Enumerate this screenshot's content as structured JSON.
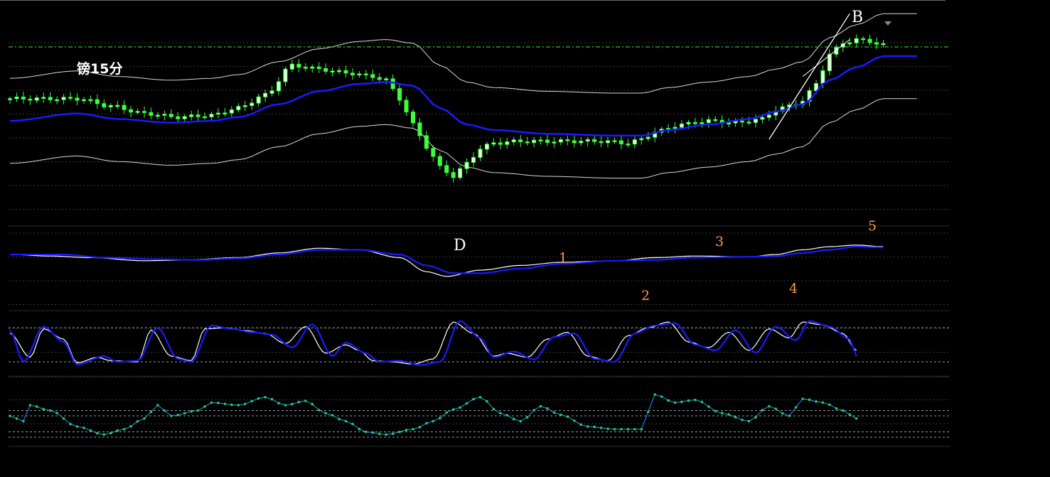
{
  "title": "镑15分",
  "colors": {
    "background": "#000000",
    "candle": "#3cff3c",
    "candle_up_body": "#e8ffe8",
    "ma_blue": "#1a1aff",
    "band_white": "#ffffff",
    "grid": "#3a3a3a",
    "guide_green": "#2fbf2f",
    "orange": "#ff9a4a",
    "osc_dots": "#22d050",
    "osc_line": "#2a78e0"
  },
  "annotations": [
    {
      "id": "label-b",
      "text": "B",
      "color": "#ffffff"
    },
    {
      "id": "label-d",
      "text": "D",
      "color": "#ffffff"
    },
    {
      "id": "label-1",
      "text": "1",
      "color": "#ff9a4a"
    },
    {
      "id": "label-2",
      "text": "2",
      "color": "#ff9a4a"
    },
    {
      "id": "label-3",
      "text": "3",
      "color": "#ff9a4a"
    },
    {
      "id": "label-4",
      "text": "4",
      "color": "#ff9a4a"
    },
    {
      "id": "label-5",
      "text": "5",
      "color": "#ff9a4a"
    }
  ],
  "chart_data": {
    "type": "candlestick",
    "title": "镑15分",
    "grid": true,
    "panels": [
      {
        "name": "price",
        "type": "candlestick",
        "bars": 136,
        "ylim": [
          0,
          100
        ],
        "close_keypoints": [
          [
            0,
            62
          ],
          [
            10,
            62
          ],
          [
            15,
            58
          ],
          [
            20,
            54
          ],
          [
            25,
            52
          ],
          [
            30,
            53
          ],
          [
            34,
            57
          ],
          [
            38,
            64
          ],
          [
            42,
            80
          ],
          [
            46,
            78
          ],
          [
            50,
            76
          ],
          [
            54,
            74
          ],
          [
            56,
            72
          ],
          [
            58,
            62
          ],
          [
            60,
            48
          ],
          [
            62,
            36
          ],
          [
            64,
            25
          ],
          [
            66,
            20
          ],
          [
            68,
            27
          ],
          [
            70,
            35
          ],
          [
            72,
            38
          ],
          [
            76,
            39
          ],
          [
            80,
            39
          ],
          [
            84,
            39
          ],
          [
            88,
            39
          ],
          [
            92,
            38
          ],
          [
            94,
            40
          ],
          [
            96,
            44
          ],
          [
            100,
            48
          ],
          [
            104,
            50
          ],
          [
            108,
            49
          ],
          [
            112,
            51
          ],
          [
            114,
            56
          ],
          [
            116,
            58
          ],
          [
            118,
            61
          ],
          [
            120,
            70
          ],
          [
            122,
            86
          ],
          [
            124,
            92
          ],
          [
            126,
            94
          ],
          [
            128,
            93
          ],
          [
            130,
            91
          ]
        ],
        "ma_keypoints": [
          [
            0,
            50
          ],
          [
            10,
            54
          ],
          [
            16,
            51
          ],
          [
            24,
            49
          ],
          [
            30,
            50
          ],
          [
            34,
            52
          ],
          [
            40,
            59
          ],
          [
            46,
            66
          ],
          [
            52,
            70
          ],
          [
            56,
            71
          ],
          [
            60,
            69
          ],
          [
            64,
            57
          ],
          [
            68,
            48
          ],
          [
            72,
            45
          ],
          [
            80,
            43
          ],
          [
            90,
            42
          ],
          [
            94,
            42
          ],
          [
            98,
            45
          ],
          [
            104,
            48
          ],
          [
            110,
            51
          ],
          [
            114,
            55
          ],
          [
            118,
            59
          ],
          [
            122,
            72
          ],
          [
            126,
            79
          ],
          [
            130,
            85
          ]
        ],
        "band_width": 23,
        "hlines": [
          {
            "y": 90,
            "style": "dash-dot",
            "color": "#2fbf2f"
          }
        ],
        "trendline": {
          "from": [
            113,
            40
          ],
          "to": [
            125,
            108
          ],
          "color": "#ffffff"
        }
      },
      {
        "name": "moving-average-oscillator",
        "type": "line",
        "ylim": [
          0,
          100
        ],
        "series": [
          {
            "color": "#ffffff",
            "keypoints": [
              [
                0,
                70
              ],
              [
                6,
                68
              ],
              [
                12,
                66
              ],
              [
                20,
                62
              ],
              [
                26,
                63
              ],
              [
                34,
                66
              ],
              [
                40,
                72
              ],
              [
                46,
                78
              ],
              [
                52,
                76
              ],
              [
                58,
                66
              ],
              [
                62,
                48
              ],
              [
                65,
                42
              ],
              [
                70,
                50
              ],
              [
                76,
                56
              ],
              [
                82,
                60
              ],
              [
                90,
                62
              ],
              [
                96,
                66
              ],
              [
                102,
                68
              ],
              [
                110,
                67
              ],
              [
                114,
                70
              ],
              [
                118,
                76
              ],
              [
                122,
                80
              ],
              [
                126,
                82
              ],
              [
                130,
                80
              ]
            ]
          },
          {
            "color": "#1a1aff",
            "keypoints": [
              [
                0,
                70
              ],
              [
                8,
                70
              ],
              [
                14,
                66
              ],
              [
                22,
                64
              ],
              [
                28,
                63
              ],
              [
                34,
                65
              ],
              [
                40,
                70
              ],
              [
                46,
                76
              ],
              [
                52,
                76
              ],
              [
                58,
                70
              ],
              [
                62,
                56
              ],
              [
                66,
                46
              ],
              [
                70,
                46
              ],
              [
                76,
                52
              ],
              [
                82,
                58
              ],
              [
                90,
                62
              ],
              [
                96,
                63
              ],
              [
                102,
                66
              ],
              [
                110,
                67
              ],
              [
                114,
                68
              ],
              [
                118,
                72
              ],
              [
                122,
                76
              ],
              [
                126,
                80
              ],
              [
                130,
                79
              ]
            ]
          }
        ]
      },
      {
        "name": "stochastic",
        "type": "line",
        "ylim": [
          0,
          100
        ],
        "hlines": [
          80,
          20
        ],
        "series": [
          {
            "color": "#ffffff",
            "keypoints": [
              [
                0,
                70
              ],
              [
                3,
                28
              ],
              [
                5,
                78
              ],
              [
                8,
                60
              ],
              [
                10,
                18
              ],
              [
                13,
                28
              ],
              [
                15,
                22
              ],
              [
                19,
                20
              ],
              [
                21,
                76
              ],
              [
                24,
                30
              ],
              [
                27,
                22
              ],
              [
                29,
                78
              ],
              [
                32,
                80
              ],
              [
                35,
                75
              ],
              [
                38,
                70
              ],
              [
                41,
                52
              ],
              [
                44,
                82
              ],
              [
                47,
                35
              ],
              [
                50,
                50
              ],
              [
                52,
                40
              ],
              [
                54,
                22
              ],
              [
                57,
                20
              ],
              [
                60,
                16
              ],
              [
                63,
                25
              ],
              [
                66,
                90
              ],
              [
                69,
                70
              ],
              [
                72,
                30
              ],
              [
                74,
                35
              ],
              [
                77,
                28
              ],
              [
                80,
                60
              ],
              [
                83,
                72
              ],
              [
                86,
                30
              ],
              [
                89,
                22
              ],
              [
                92,
                66
              ],
              [
                95,
                80
              ],
              [
                98,
                90
              ],
              [
                101,
                55
              ],
              [
                104,
                45
              ],
              [
                107,
                72
              ],
              [
                110,
                40
              ],
              [
                113,
                78
              ],
              [
                116,
                62
              ],
              [
                118,
                90
              ],
              [
                121,
                85
              ],
              [
                124,
                70
              ],
              [
                126,
                40
              ]
            ]
          },
          {
            "color": "#1a1aff",
            "keypoints": [
              [
                0,
                75
              ],
              [
                2,
                20
              ],
              [
                5,
                82
              ],
              [
                8,
                55
              ],
              [
                10,
                15
              ],
              [
                14,
                30
              ],
              [
                16,
                20
              ],
              [
                19,
                22
              ],
              [
                22,
                80
              ],
              [
                25,
                25
              ],
              [
                27,
                20
              ],
              [
                30,
                84
              ],
              [
                33,
                78
              ],
              [
                36,
                72
              ],
              [
                39,
                68
              ],
              [
                42,
                45
              ],
              [
                45,
                86
              ],
              [
                48,
                30
              ],
              [
                50,
                54
              ],
              [
                53,
                35
              ],
              [
                55,
                20
              ],
              [
                58,
                22
              ],
              [
                61,
                14
              ],
              [
                64,
                20
              ],
              [
                67,
                92
              ],
              [
                70,
                62
              ],
              [
                72,
                28
              ],
              [
                75,
                38
              ],
              [
                78,
                24
              ],
              [
                81,
                64
              ],
              [
                84,
                70
              ],
              [
                87,
                25
              ],
              [
                90,
                20
              ],
              [
                93,
                70
              ],
              [
                96,
                84
              ],
              [
                99,
                88
              ],
              [
                102,
                50
              ],
              [
                105,
                40
              ],
              [
                108,
                76
              ],
              [
                111,
                36
              ],
              [
                114,
                82
              ],
              [
                117,
                58
              ],
              [
                119,
                92
              ],
              [
                122,
                82
              ],
              [
                125,
                60
              ],
              [
                126,
                30
              ]
            ]
          }
        ]
      },
      {
        "name": "momentum",
        "type": "line",
        "ylim": [
          0,
          100
        ],
        "hlines": [
          50,
          40,
          10,
          0
        ],
        "series": [
          {
            "color": "#2a78e0",
            "marker": "dot",
            "keypoints": [
              [
                0,
                40
              ],
              [
                2,
                30
              ],
              [
                3,
                60
              ],
              [
                6,
                50
              ],
              [
                10,
                20
              ],
              [
                14,
                5
              ],
              [
                17,
                15
              ],
              [
                20,
                35
              ],
              [
                22,
                60
              ],
              [
                24,
                40
              ],
              [
                28,
                50
              ],
              [
                30,
                65
              ],
              [
                34,
                60
              ],
              [
                38,
                75
              ],
              [
                41,
                60
              ],
              [
                44,
                68
              ],
              [
                47,
                45
              ],
              [
                50,
                30
              ],
              [
                53,
                10
              ],
              [
                56,
                5
              ],
              [
                60,
                15
              ],
              [
                63,
                30
              ],
              [
                66,
                52
              ],
              [
                70,
                75
              ],
              [
                73,
                45
              ],
              [
                76,
                30
              ],
              [
                79,
                58
              ],
              [
                82,
                42
              ],
              [
                86,
                20
              ],
              [
                90,
                15
              ],
              [
                94,
                15
              ],
              [
                96,
                80
              ],
              [
                99,
                65
              ],
              [
                102,
                70
              ],
              [
                106,
                45
              ],
              [
                110,
                30
              ],
              [
                113,
                58
              ],
              [
                116,
                40
              ],
              [
                118,
                72
              ],
              [
                121,
                65
              ],
              [
                124,
                50
              ],
              [
                126,
                35
              ]
            ]
          }
        ]
      }
    ]
  }
}
